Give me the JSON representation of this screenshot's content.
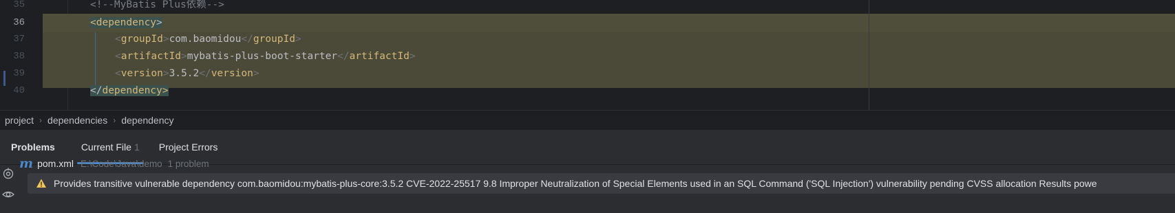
{
  "editor": {
    "lines": [
      {
        "num": "35",
        "comment": "<!--MyBatis Plus依赖-->"
      },
      {
        "num": "36",
        "open": "<",
        "tag": "dependency",
        "close": ">"
      },
      {
        "num": "37",
        "tag_open": "groupId",
        "value": "com.baomidou",
        "tag_close": "groupId"
      },
      {
        "num": "38",
        "tag_open": "artifactId",
        "value": "mybatis-plus-boot-starter",
        "tag_close": "artifactId"
      },
      {
        "num": "39",
        "tag_open": "version",
        "value": "3.5.2",
        "tag_close": "version"
      },
      {
        "num": "40",
        "tag": "dependency"
      }
    ],
    "current_line": "36",
    "highlight_color": "#4b4a38",
    "tag_color": "#d5b778"
  },
  "breadcrumb": {
    "items": [
      "project",
      "dependencies",
      "dependency"
    ]
  },
  "problems": {
    "tabs": [
      {
        "label": "Problems"
      },
      {
        "label": "Current File",
        "count": "1"
      },
      {
        "label": "Project Errors"
      }
    ],
    "active_tab": "Current File",
    "file": {
      "icon": "maven-icon",
      "icon_glyph": "m",
      "name": "pom.xml",
      "path": "E:\\Code\\Java\\demo",
      "count": "1 problem"
    },
    "item": {
      "icon": "warning-icon",
      "text": "Provides transitive vulnerable dependency com.baomidou:mybatis-plus-core:3.5.2 CVE-2022-25517 9.8 Improper Neutralization of Special Elements used in an SQL Command ('SQL Injection') vulnerability pending CVSS allocation  Results powe"
    },
    "side_icons": [
      "auto-scroll-icon",
      "eye-icon"
    ],
    "accent_color": "#4a88c7",
    "warning_color": "#f2c55c"
  }
}
